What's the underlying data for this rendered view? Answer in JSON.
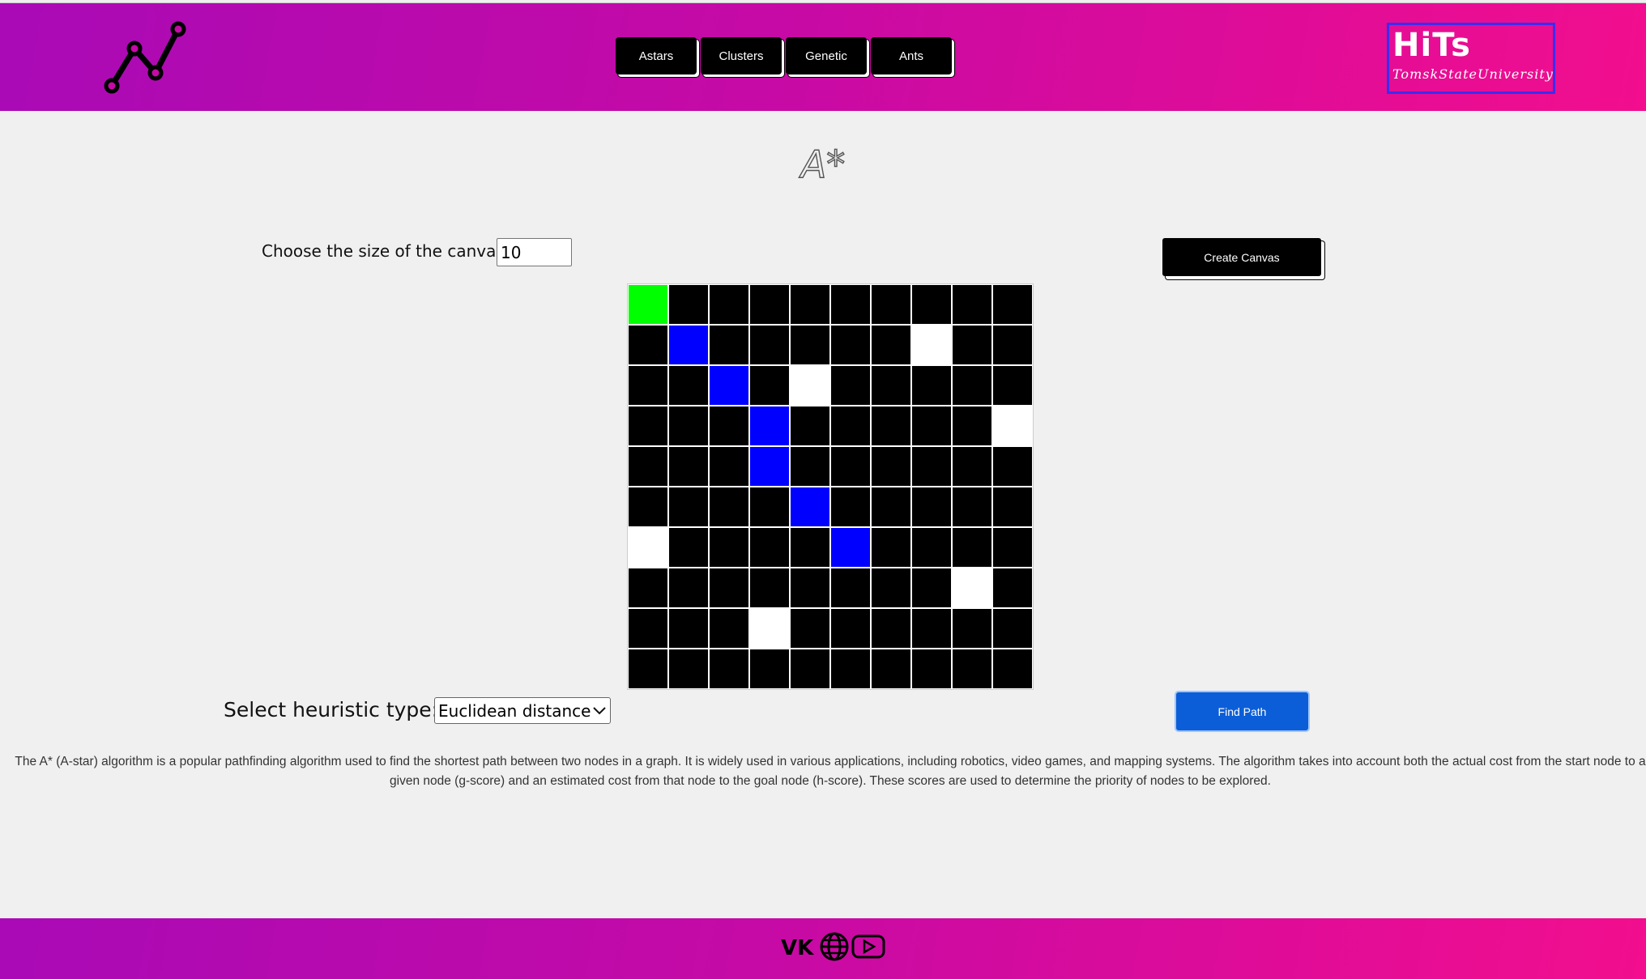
{
  "nav": {
    "items": [
      {
        "label": "Astars"
      },
      {
        "label": "Clusters"
      },
      {
        "label": "Genetic"
      },
      {
        "label": "Ants"
      }
    ]
  },
  "brand": {
    "title": "HiTs",
    "subtitle": "TomskStateUniversity"
  },
  "page": {
    "title": "A*"
  },
  "canvas_size": {
    "label": "Choose the size of the canvas:",
    "value": "10"
  },
  "create_button": {
    "label": "Create Canvas"
  },
  "grid": {
    "size": 10,
    "start": [
      [
        0,
        0
      ]
    ],
    "path": [
      [
        1,
        1
      ],
      [
        2,
        2
      ],
      [
        3,
        3
      ],
      [
        4,
        3
      ],
      [
        5,
        4
      ],
      [
        6,
        5
      ]
    ],
    "walls": [
      [
        1,
        7
      ],
      [
        2,
        4
      ],
      [
        3,
        9
      ],
      [
        6,
        0
      ],
      [
        7,
        8
      ],
      [
        8,
        3
      ]
    ],
    "colors": {
      "start": "#00ff00",
      "path": "#0000ff",
      "wall": "#ffffff",
      "empty": "#000000"
    }
  },
  "heuristic": {
    "label": "Select heuristic type:",
    "selected": "Euclidean distance"
  },
  "find_button": {
    "label": "Find Path"
  },
  "description": "The A* (A-star) algorithm is a popular pathfinding algorithm used to find the shortest path between two nodes in a graph. It is widely used in various applications, including robotics, video games, and mapping systems. The algorithm takes into account both the actual cost from the start node to a given node (g-score) and an estimated cost from that node to the goal node (h-score). These scores are used to determine the priority of nodes to be explored.",
  "footer": {
    "icons": [
      "vk-icon",
      "globe-icon",
      "youtube-icon"
    ]
  },
  "colors": {
    "header_gradient_start": "#a90ab6",
    "header_gradient_end": "#f20e8e",
    "accent_blue": "#0b5ed7"
  }
}
